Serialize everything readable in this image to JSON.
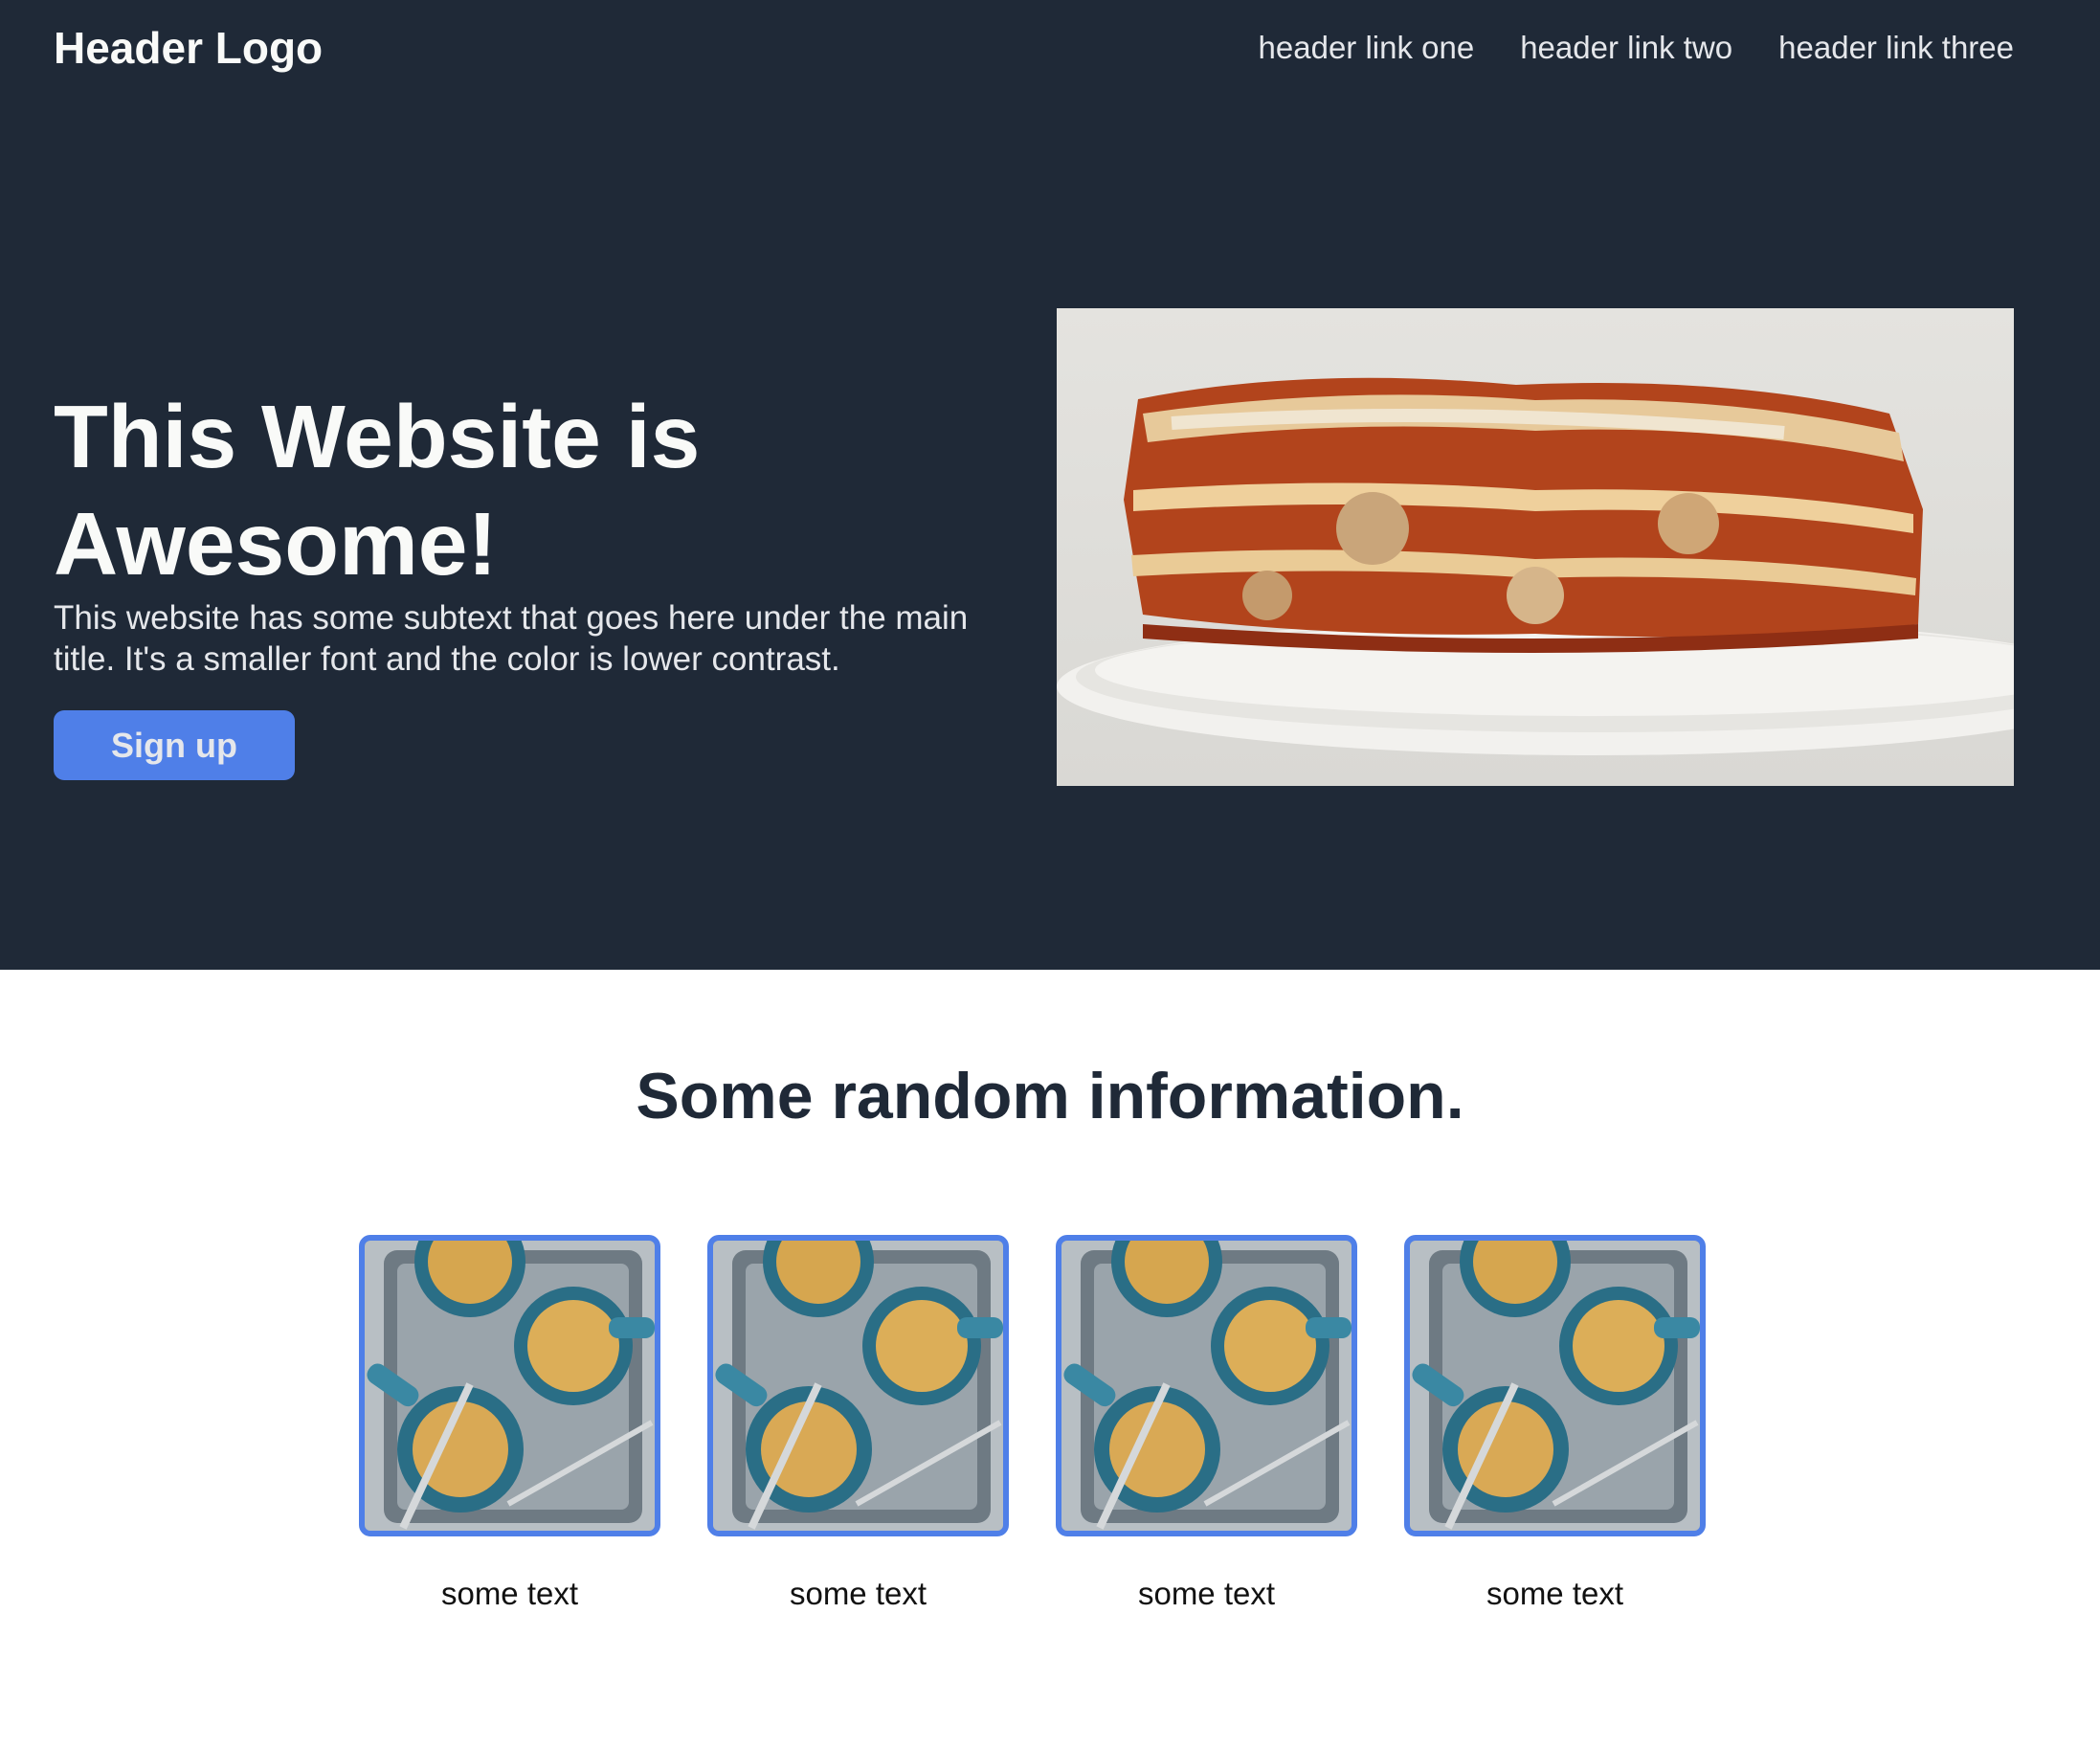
{
  "header": {
    "logo": "Header Logo",
    "links": [
      "header link one",
      "header link two",
      "header link three"
    ]
  },
  "hero": {
    "title": "This Website is Awesome!",
    "subtext": "This website has some subtext that goes here under the main title. It's a smaller font and the color is lower contrast.",
    "button_label": "Sign up",
    "image_icon": "lasagna-photo"
  },
  "info": {
    "title": "Some random information.",
    "cards": [
      {
        "text": "some text",
        "image_icon": "soup-bowls-photo"
      },
      {
        "text": "some text",
        "image_icon": "soup-bowls-photo"
      },
      {
        "text": "some text",
        "image_icon": "soup-bowls-photo"
      },
      {
        "text": "some text",
        "image_icon": "soup-bowls-photo"
      }
    ]
  },
  "colors": {
    "dark_background": "#1f2937",
    "accent": "#4f7fe8",
    "title_text": "#f9faf8",
    "sub_text": "#e5e7eb"
  }
}
